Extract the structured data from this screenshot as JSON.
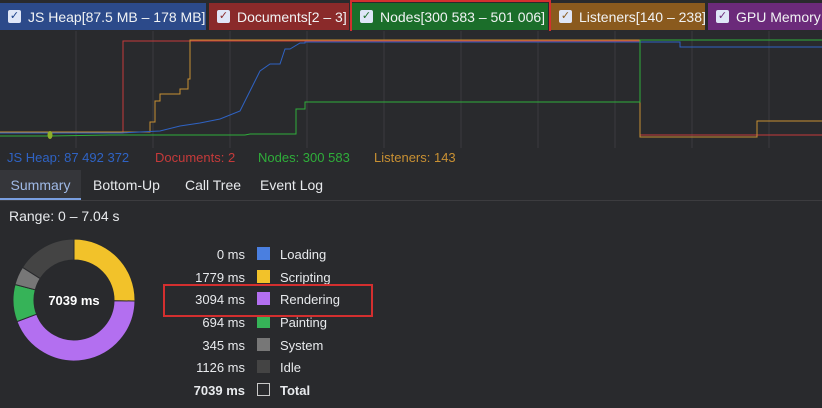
{
  "legend": [
    {
      "label": "JS Heap[87.5 MB – 178 MB]",
      "checked": true,
      "color": "#2c4a8a"
    },
    {
      "label": "Documents[2 – 3]",
      "checked": true,
      "color": "#8a2a2a"
    },
    {
      "label": "Nodes[300 583 – 501 006]",
      "checked": true,
      "color": "#1b6e2a"
    },
    {
      "label": "Listeners[140 – 238]",
      "checked": true,
      "color": "#8a5a1e"
    },
    {
      "label": "GPU Memory",
      "checked": true,
      "color": "#6b2a7a"
    }
  ],
  "counters": {
    "heap": "JS Heap: 87 492 372",
    "documents": "Documents: 2",
    "nodes": "Nodes: 300 583",
    "listeners": "Listeners: 143"
  },
  "tabs": [
    "Summary",
    "Bottom-Up",
    "Call Tree",
    "Event Log"
  ],
  "active_tab": "Summary",
  "summary": {
    "range": "Range: 0 – 7.04 s",
    "total_center": "7039 ms",
    "items": [
      {
        "ms": "0 ms",
        "name": "Loading",
        "color": "#4a7fe0",
        "value": 0
      },
      {
        "ms": "1779 ms",
        "name": "Scripting",
        "color": "#f2c22a",
        "value": 1779
      },
      {
        "ms": "3094 ms",
        "name": "Rendering",
        "color": "#b36ff0",
        "value": 3094
      },
      {
        "ms": "694 ms",
        "name": "Painting",
        "color": "#36b358",
        "value": 694
      },
      {
        "ms": "345 ms",
        "name": "System",
        "color": "#777777",
        "value": 345
      },
      {
        "ms": "1126 ms",
        "name": "Idle",
        "color": "#444444",
        "value": 1126
      },
      {
        "ms": "7039 ms",
        "name": "Total",
        "color": "#292a2d",
        "value": 7039
      }
    ]
  },
  "colors": {
    "heap_line": "#2f63c4",
    "documents_line": "#c53a3a",
    "nodes_line": "#2fae3a",
    "listeners_line": "#c89033"
  }
}
